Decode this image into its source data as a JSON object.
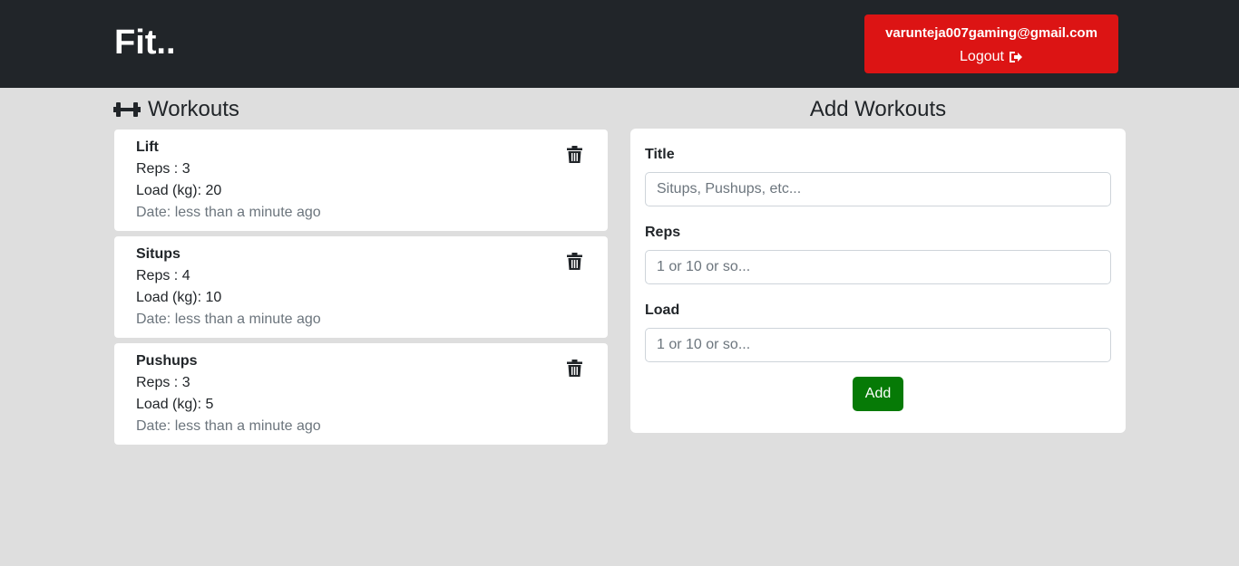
{
  "navbar": {
    "brand": "Fit..",
    "user_email": "varunteja007gaming@gmail.com",
    "logout_label": "Logout"
  },
  "workouts": {
    "heading": "Workouts",
    "items": [
      {
        "title": "Lift",
        "reps": "Reps : 3",
        "load": "Load (kg): 20",
        "date": "Date: less than a minute ago"
      },
      {
        "title": "Situps",
        "reps": "Reps : 4",
        "load": "Load (kg): 10",
        "date": "Date: less than a minute ago"
      },
      {
        "title": "Pushups",
        "reps": "Reps : 3",
        "load": "Load (kg): 5",
        "date": "Date: less than a minute ago"
      }
    ]
  },
  "add_form": {
    "heading": "Add Workouts",
    "title_label": "Title",
    "title_placeholder": "Situps, Pushups, etc...",
    "reps_label": "Reps",
    "reps_placeholder": "1 or 10 or so...",
    "load_label": "Load",
    "load_placeholder": "1 or 10 or so...",
    "submit_label": "Add"
  },
  "colors": {
    "navbar_bg": "#212529",
    "user_box_bg": "#dc1414",
    "page_bg": "#dedede",
    "add_button_bg": "#067a06"
  },
  "icons": {
    "workouts_heading": "dumbbell-icon",
    "logout": "sign-out-icon",
    "delete": "trash-icon"
  }
}
